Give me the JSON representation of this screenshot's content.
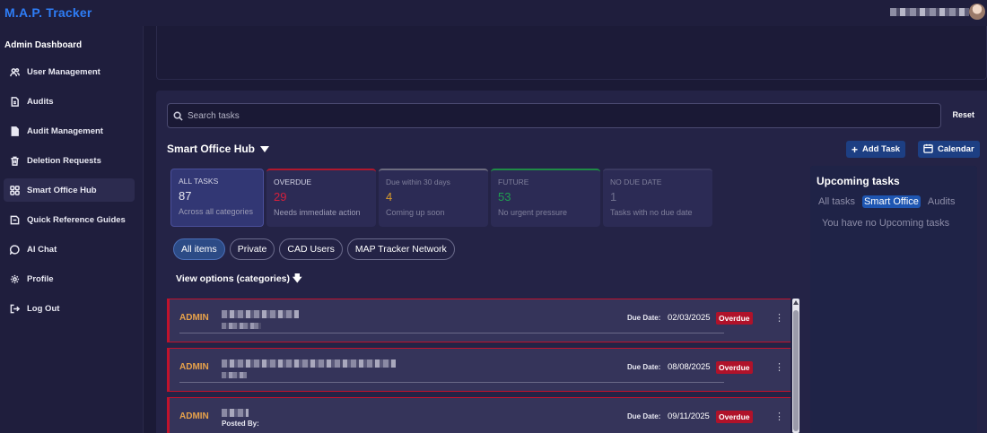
{
  "app": {
    "brand": "M.A.P. Tracker"
  },
  "sidebar": {
    "title": "Admin Dashboard",
    "items": [
      {
        "label": "User Management",
        "icon": "users-icon"
      },
      {
        "label": "Audits",
        "icon": "file-icon"
      },
      {
        "label": "Audit Management",
        "icon": "document-icon"
      },
      {
        "label": "Deletion Requests",
        "icon": "trash-icon"
      },
      {
        "label": "Smart Office Hub",
        "icon": "grid-icon",
        "active": true
      },
      {
        "label": "Quick Reference Guides",
        "icon": "book-icon"
      },
      {
        "label": "AI Chat",
        "icon": "chat-icon"
      },
      {
        "label": "Profile",
        "icon": "gear-icon"
      },
      {
        "label": "Log Out",
        "icon": "logout-icon"
      }
    ]
  },
  "search": {
    "placeholder": "Search tasks",
    "reset_label": "Reset"
  },
  "hub": {
    "title": "Smart Office Hub",
    "add_task_label": "Add Task",
    "calendar_label": "Calendar"
  },
  "stats": [
    {
      "label": "ALL TASKS",
      "value": "87",
      "sub": "Across all categories"
    },
    {
      "label": "OVERDUE",
      "value": "29",
      "sub": "Needs immediate action"
    },
    {
      "label": "Due within 30 days",
      "value": "4",
      "sub": "Coming up soon"
    },
    {
      "label": "FUTURE",
      "value": "53",
      "sub": "No urgent pressure"
    },
    {
      "label": "NO DUE DATE",
      "value": "1",
      "sub": "Tasks with no due date"
    }
  ],
  "filters": {
    "items": [
      "All items",
      "Private",
      "CAD Users",
      "MAP Tracker Network"
    ],
    "selected": "All items"
  },
  "view_options_label": "View options (categories)",
  "tasks": [
    {
      "owner": "ADMIN",
      "due_label": "Due Date:",
      "due_date": "02/03/2025",
      "status": "Overdue"
    },
    {
      "owner": "ADMIN",
      "due_label": "Due Date:",
      "due_date": "08/08/2025",
      "status": "Overdue"
    },
    {
      "owner": "ADMIN",
      "posted_by_label": "Posted By:",
      "due_label": "Due Date:",
      "due_date": "09/11/2025",
      "status": "Overdue"
    }
  ],
  "upcoming": {
    "title": "Upcoming tasks",
    "tabs": [
      "All tasks",
      "Smart Office",
      "Audits"
    ],
    "selected_tab": "Smart Office",
    "empty_text": "You have no Upcoming tasks"
  },
  "colors": {
    "brand": "#2e7df6",
    "overdue": "#c1122c",
    "accent_button": "#1d3f83",
    "owner": "#e8a24a"
  }
}
